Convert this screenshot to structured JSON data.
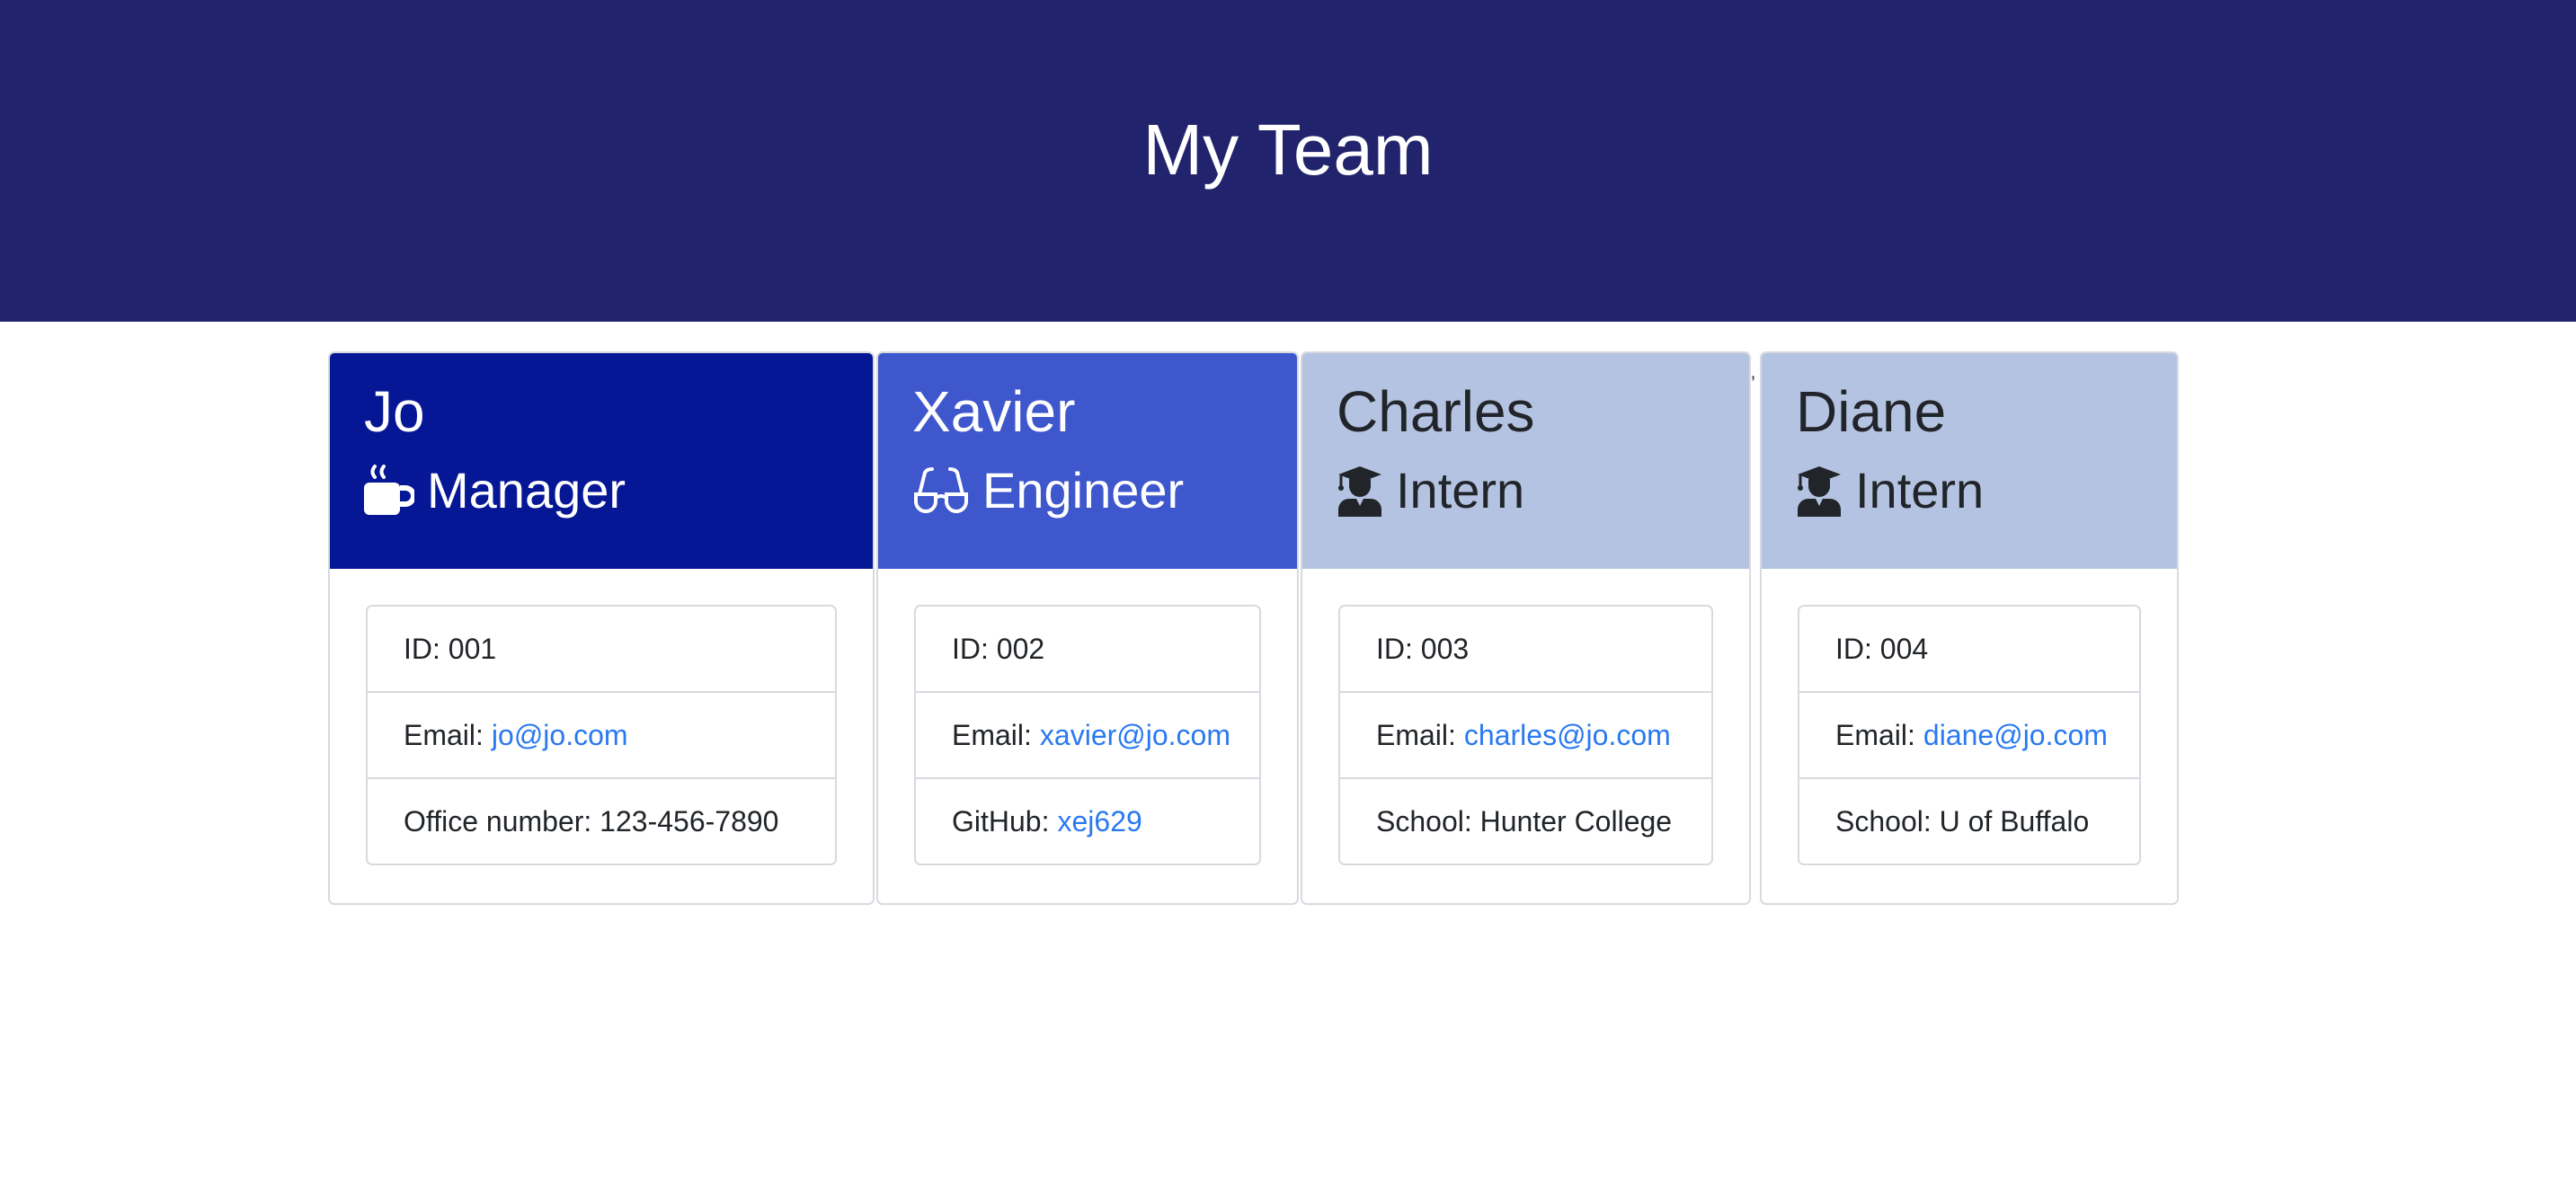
{
  "header": {
    "title": "My Team",
    "background": "#21246c"
  },
  "colors": {
    "manager_header": "#061795",
    "engineer_header": "#3e57cc",
    "intern_header": "#b5c3e2",
    "link": "#2a79f0",
    "card_border": "#d7dadf"
  },
  "cards": [
    {
      "name": "Jo",
      "role": "Manager",
      "icon": "coffee-mug-icon",
      "id_label": "ID: 001",
      "email_label": "Email:",
      "email": "jo@jo.com",
      "extra": "Office number: 123-456-7890"
    },
    {
      "name": "Xavier",
      "role": "Engineer",
      "icon": "glasses-icon",
      "id_label": "ID: 002",
      "email_label": "Email:",
      "email": "xavier@jo.com",
      "extra_label": "GitHub:",
      "extra_link": "xej629"
    },
    {
      "name": "Charles",
      "role": "Intern",
      "icon": "graduate-icon",
      "id_label": "ID: 003",
      "email_label": "Email:",
      "email": "charles@jo.com",
      "extra": "School: Hunter College"
    },
    {
      "name": "Diane",
      "role": "Intern",
      "icon": "graduate-icon",
      "id_label": "ID: 004",
      "email_label": "Email:",
      "email": "diane@jo.com",
      "extra": "School: U of Buffalo"
    }
  ],
  "stray_mark": "’"
}
